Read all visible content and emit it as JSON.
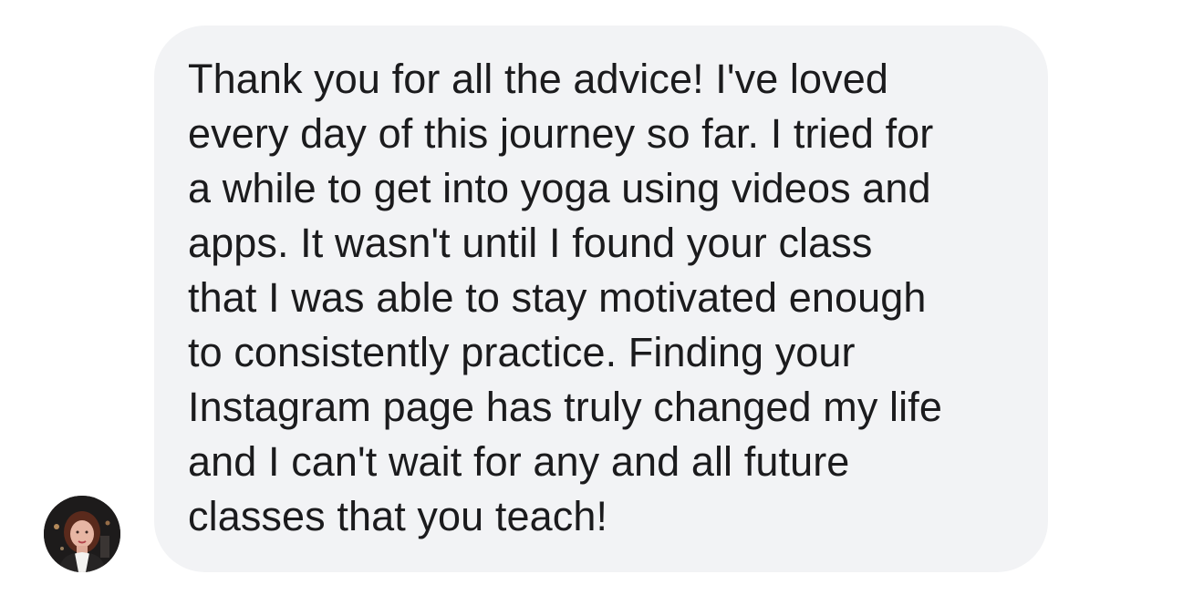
{
  "thread": {
    "received_message": {
      "sender_avatar_icon": "profile-photo-icon",
      "lines": [
        "Thank you for all the advice! I've loved",
        "every day of this journey so far. I tried for",
        "a while to get into yoga using videos and",
        "apps. It wasn't until I found your class",
        "that I was able to stay motivated enough",
        "to consistently practice. Finding your",
        "Instagram page has truly changed my life",
        "and I can't wait for any and all future",
        "classes that you teach!"
      ]
    }
  },
  "colors": {
    "background": "#ffffff",
    "bubble": "#f2f3f5",
    "text": "#1b1b1d"
  }
}
